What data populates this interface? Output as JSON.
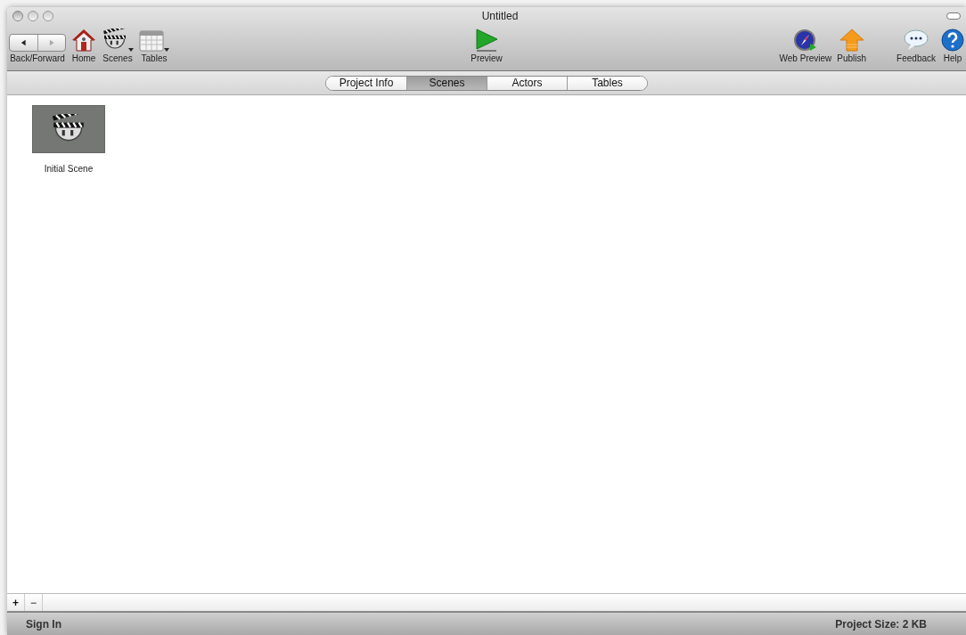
{
  "window": {
    "title": "Untitled"
  },
  "toolbar_left": [
    {
      "kind": "backforward",
      "label": "Back/Forward"
    },
    {
      "kind": "home",
      "label": "Home"
    },
    {
      "kind": "scenes",
      "label": "Scenes"
    },
    {
      "kind": "tables",
      "label": "Tables"
    }
  ],
  "toolbar_center": [
    {
      "kind": "preview",
      "label": "Preview"
    }
  ],
  "toolbar_right": [
    {
      "kind": "webpreview",
      "label": "Web Preview"
    },
    {
      "kind": "publish",
      "label": "Publish"
    },
    {
      "kind": "feedback",
      "label": "Feedback"
    },
    {
      "kind": "help",
      "label": "Help"
    }
  ],
  "tabs": [
    {
      "label": "Project Info",
      "selected": false
    },
    {
      "label": "Scenes",
      "selected": true
    },
    {
      "label": "Actors",
      "selected": false
    },
    {
      "label": "Tables",
      "selected": false
    }
  ],
  "scenes": [
    {
      "name": "Initial Scene",
      "selected": true
    }
  ],
  "list_buttons": [
    "+",
    "−"
  ],
  "status_bar": {
    "left": "Sign In",
    "right": "Project Size: 2 KB"
  }
}
